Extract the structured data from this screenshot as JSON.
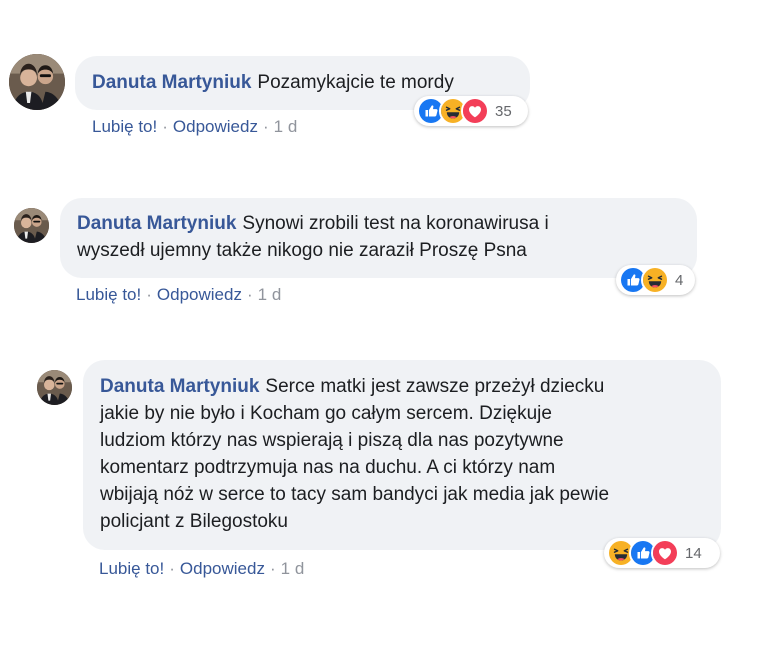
{
  "comments": [
    {
      "author": "Danuta Martyniuk",
      "text": "Pozamykajcie te mordy",
      "like_label": "Lubię to!",
      "reply_label": "Odpowiedz",
      "time": "1 d",
      "reactions": [
        "like-icon",
        "haha-icon",
        "love-icon"
      ],
      "reaction_count": "35"
    },
    {
      "author": "Danuta Martyniuk",
      "text_lines": [
        "Synowi zrobili test na koronawirusa i",
        "wyszedł ujemny także nikogo nie zaraził Proszę Psna"
      ],
      "like_label": "Lubię to!",
      "reply_label": "Odpowiedz",
      "time": "1 d",
      "reactions": [
        "like-icon",
        "haha-icon"
      ],
      "reaction_count": "4"
    },
    {
      "author": "Danuta Martyniuk",
      "text_lines": [
        "Serce matki jest zawsze przeżył dziecku",
        "jakie by nie było i Kocham go całym sercem. Dziękuje",
        "ludziom którzy nas wspierają i piszą dla nas pozytywne",
        "komentarz podtrzymuja nas na duchu. A ci którzy nam",
        "wbijają nóż w serce to tacy sam bandyci jak media jak pewie",
        "policjant z Bilegostoku"
      ],
      "like_label": "Lubię to!",
      "reply_label": "Odpowiedz",
      "time": "1 d",
      "reactions": [
        "haha-icon",
        "like-icon",
        "love-icon"
      ],
      "reaction_count": "14"
    }
  ],
  "colors": {
    "author": "#385898",
    "bubble": "#f0f2f5",
    "like": "#1877f2",
    "haha": "#f7b125",
    "love": "#f33e58"
  }
}
